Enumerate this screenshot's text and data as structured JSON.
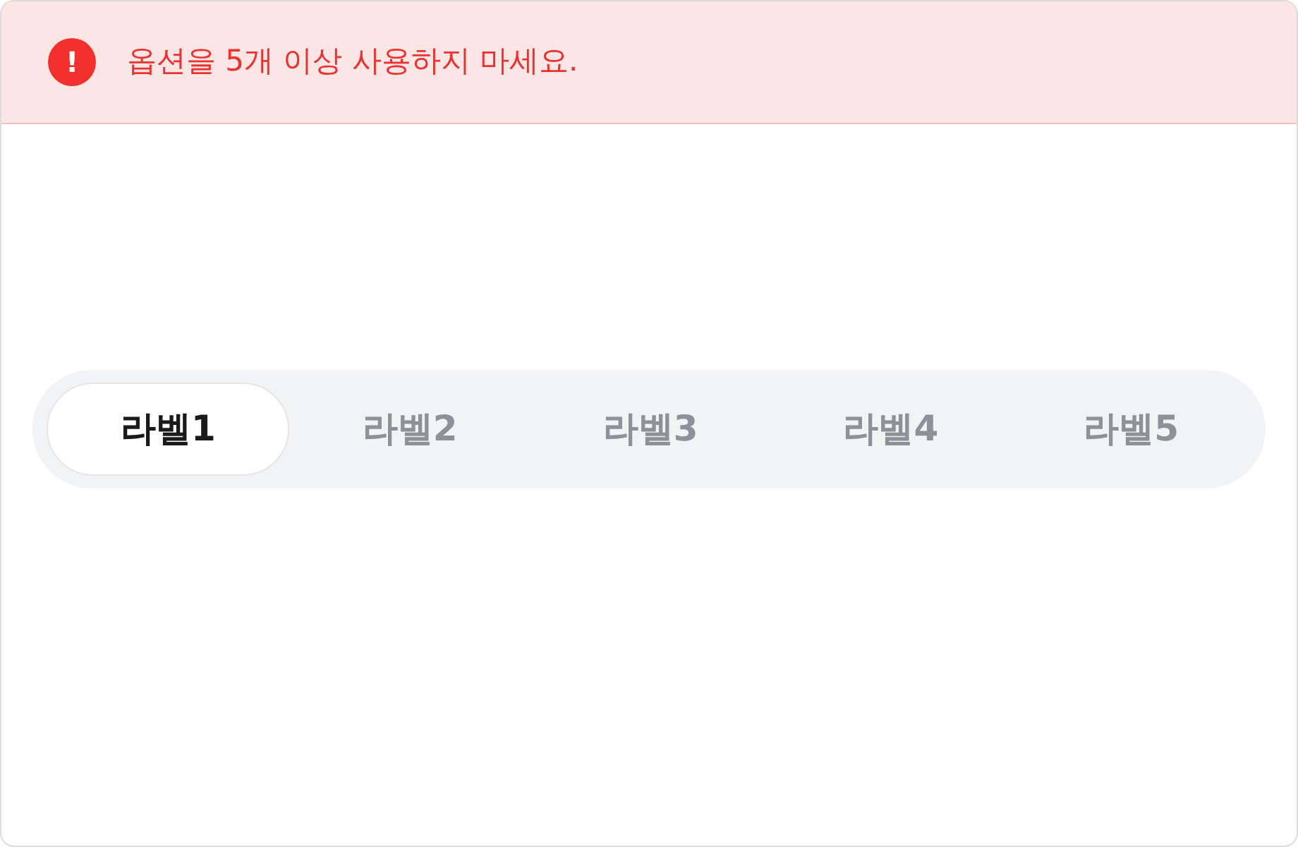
{
  "alert": {
    "message": "옵션을 5개 이상 사용하지 마세요.",
    "icon": "!"
  },
  "segments": [
    {
      "label": "라벨1",
      "selected": true
    },
    {
      "label": "라벨2",
      "selected": false
    },
    {
      "label": "라벨3",
      "selected": false
    },
    {
      "label": "라벨4",
      "selected": false
    },
    {
      "label": "라벨5",
      "selected": false
    }
  ]
}
